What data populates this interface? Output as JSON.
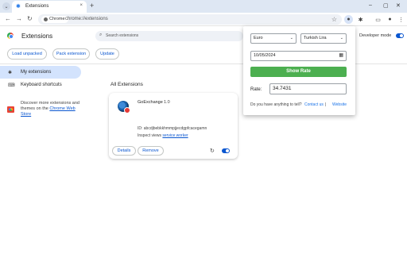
{
  "browser": {
    "tab": {
      "title": "Extensions",
      "close": "×"
    },
    "new_tab": "+",
    "window_controls": {
      "minimize": "–",
      "maximize": "▢",
      "close": "✕"
    },
    "nav": {
      "back": "←",
      "forward": "→",
      "reload": "↻"
    },
    "omnibox": {
      "chip": "Chrome",
      "url": "chrome://extensions"
    }
  },
  "page": {
    "title": "Extensions",
    "search_placeholder": "Search extensions",
    "developer_mode_label": "Developer mode",
    "developer_mode_on": true,
    "actions": {
      "load_unpacked": "Load unpacked",
      "pack_extension": "Pack extension",
      "update": "Update"
    },
    "sidebar": {
      "items": [
        {
          "label": "My extensions",
          "active": true
        },
        {
          "label": "Keyboard shortcuts",
          "active": false
        }
      ],
      "note_text": "Discover more extensions and themes on the ",
      "note_link": "Chrome Web Store"
    },
    "section_title": "All Extensions",
    "extension": {
      "name": "GoExchange",
      "version": "1.0",
      "id_text": "ID: abcdjbebkkhmmpjjecdgpfcacegamn",
      "inspect_label": "Inspect views ",
      "inspect_link": "service worker",
      "details_label": "Details",
      "remove_label": "Remove",
      "enabled": true
    }
  },
  "popup": {
    "from_currency": "Euro",
    "to_currency": "Turkish Lira",
    "date": "10/05/2024",
    "show_button": "Show Rate",
    "rate_label": "Rate:",
    "rate_value": "34.7431",
    "feedback_text": "Do you have anything to tell?",
    "contact_link": "Contact us",
    "separator": "|",
    "website_link": "Website"
  },
  "colors": {
    "accent": "#0b57d0",
    "show_button": "#4caf50",
    "tabstrip": "#dee7f3"
  }
}
